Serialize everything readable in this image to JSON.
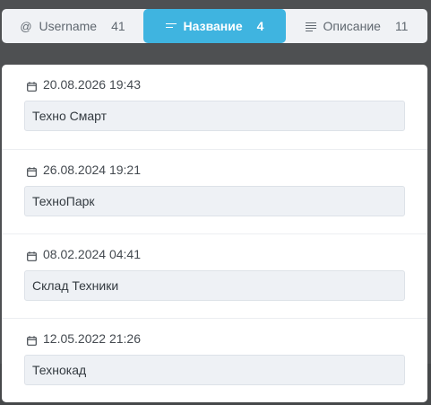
{
  "tabs": [
    {
      "label": "Username",
      "count": "41",
      "icon": "at-icon",
      "active": false
    },
    {
      "label": "Название",
      "count": "4",
      "icon": "lines-icon",
      "active": true
    },
    {
      "label": "Описание",
      "count": "11",
      "icon": "paragraph-icon",
      "active": false
    }
  ],
  "entries": [
    {
      "date": "20.08.2026 19:43",
      "value": "Техно Смарт"
    },
    {
      "date": "26.08.2024 19:21",
      "value": "ТехноПарк"
    },
    {
      "date": "08.02.2024 04:41",
      "value": "Склад Техники"
    },
    {
      "date": "12.05.2022 21:26",
      "value": "Технокад"
    }
  ],
  "colors": {
    "accent": "#3fb4e0",
    "backdrop": "#4e5052",
    "field_bg": "#eef1f5"
  }
}
